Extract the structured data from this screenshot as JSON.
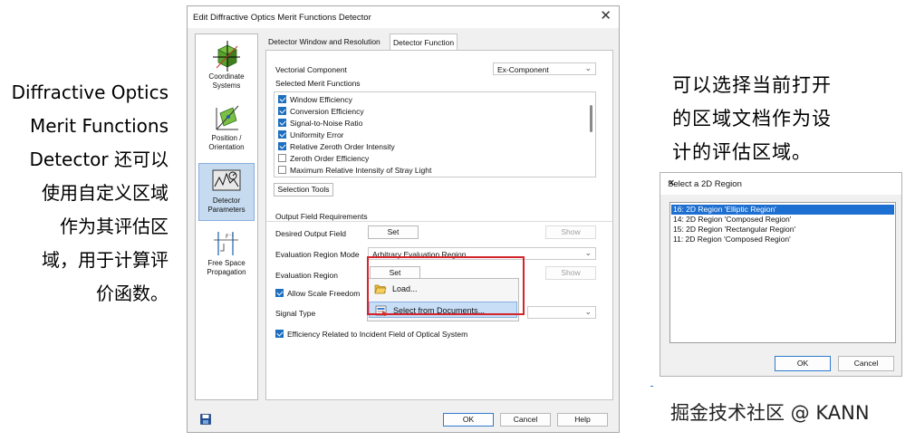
{
  "annotation_left": [
    "Diffractive Optics",
    "Merit Functions",
    "Detector 还可以",
    "使用自定义区域",
    "作为其评估区",
    "域，用于计算评",
    "价函数。"
  ],
  "annotation_right": [
    "可以选择当前打开",
    "的区域文档作为设",
    "计的评估区域。"
  ],
  "watermark": "掘金技术社区 @ KANN",
  "main_dialog": {
    "title": "Edit Diffractive Optics Merit Functions Detector",
    "nav": [
      {
        "label": [
          "Coordinate",
          "Systems"
        ],
        "icon": "coordinate-cube-icon"
      },
      {
        "label": [
          "Position /",
          "Orientation"
        ],
        "icon": "position-orientation-icon"
      },
      {
        "label": [
          "Detector",
          "Parameters"
        ],
        "icon": "detector-parameters-icon",
        "active": true
      },
      {
        "label": [
          "Free Space",
          "Propagation"
        ],
        "icon": "free-space-propagation-icon"
      }
    ],
    "tabs": [
      "Detector Window and Resolution",
      "Detector Function"
    ],
    "vectorial_component_label": "Vectorial Component",
    "vectorial_component_value": "Ex-Component",
    "selected_merit_label": "Selected Merit Functions",
    "merit_functions": [
      {
        "label": "Window Efficiency",
        "checked": true
      },
      {
        "label": "Conversion Efficiency",
        "checked": true
      },
      {
        "label": "Signal-to-Noise Ratio",
        "checked": true
      },
      {
        "label": "Uniformity Error",
        "checked": true
      },
      {
        "label": "Relative Zeroth Order Intensity",
        "checked": true
      },
      {
        "label": "Zeroth Order Efficiency",
        "checked": false
      },
      {
        "label": "Maximum Relative Intensity of Stray Light",
        "checked": false
      }
    ],
    "selection_tools": "Selection Tools",
    "output_field_requirements": "Output Field Requirements",
    "desired_output_field": "Desired Output Field",
    "set": "Set",
    "show": "Show",
    "evaluation_region_mode_label": "Evaluation Region Mode",
    "evaluation_region_mode_value": "Arbitrary Evaluation Region",
    "evaluation_region": "Evaluation Region",
    "allow_scale_freedom": "Allow Scale Freedom",
    "signal_type": "Signal Type",
    "efficiency_related": "Efficiency Related to Incident Field of Optical System",
    "popup_menu": [
      "Load...",
      "Select from Documents..."
    ],
    "ok": "OK",
    "cancel": "Cancel",
    "help": "Help"
  },
  "region_dialog": {
    "title": "Select a 2D Region",
    "regions": [
      {
        "label": "16: 2D Region 'Elliptic Region'",
        "selected": true
      },
      {
        "label": "14: 2D Region 'Composed Region'",
        "selected": false
      },
      {
        "label": "15: 2D Region 'Rectangular Region'",
        "selected": false
      },
      {
        "label": "11: 2D Region 'Composed Region'",
        "selected": false
      }
    ],
    "ok": "OK",
    "cancel": "Cancel"
  },
  "colors": {
    "selection": "#1d6fd1",
    "highlight_frame": "#d4242c",
    "active_nav": "#c6dbef"
  }
}
